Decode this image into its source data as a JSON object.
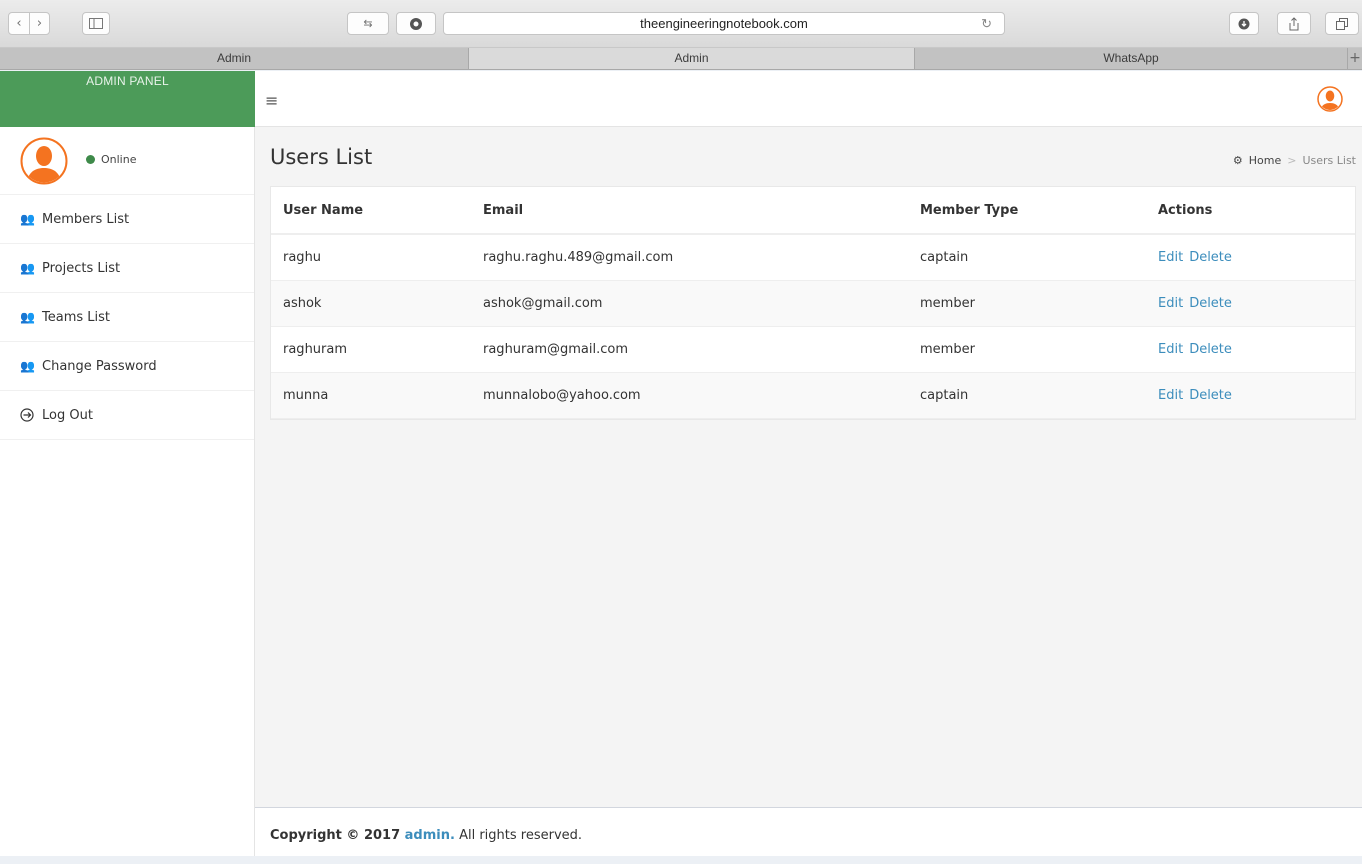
{
  "browser": {
    "url": "theengineeringnotebook.com",
    "tabs": [
      {
        "label": "Admin",
        "active": false
      },
      {
        "label": "Admin",
        "active": true
      },
      {
        "label": "WhatsApp",
        "active": false
      }
    ],
    "new_tab": "+"
  },
  "brand": {
    "label": "ADMIN PANEL",
    "color": "#4c9b59"
  },
  "user_panel": {
    "status": "Online"
  },
  "sidebar": {
    "items": [
      {
        "label": "Members List",
        "icon": "users-icon"
      },
      {
        "label": "Projects List",
        "icon": "users-icon"
      },
      {
        "label": "Teams List",
        "icon": "users-icon"
      },
      {
        "label": "Change Password",
        "icon": "users-icon"
      },
      {
        "label": "Log Out",
        "icon": "logout-icon"
      }
    ]
  },
  "header": {
    "menu_icon": "hamburger-icon",
    "avatar_icon": "user-avatar-icon",
    "accent": "#f47320"
  },
  "page": {
    "title": "Users List",
    "breadcrumb": {
      "home": "Home",
      "separator": ">",
      "current": "Users List"
    }
  },
  "table": {
    "columns": [
      "User Name",
      "Email",
      "Member Type",
      "Actions"
    ],
    "rows": [
      {
        "username": "raghu",
        "email": "raghu.raghu.489@gmail.com",
        "type": "captain",
        "edit": "Edit",
        "delete": "Delete"
      },
      {
        "username": "ashok",
        "email": "ashok@gmail.com",
        "type": "member",
        "edit": "Edit",
        "delete": "Delete"
      },
      {
        "username": "raghuram",
        "email": "raghuram@gmail.com",
        "type": "member",
        "edit": "Edit",
        "delete": "Delete"
      },
      {
        "username": "munna",
        "email": "munnalobo@yahoo.com",
        "type": "captain",
        "edit": "Edit",
        "delete": "Delete"
      }
    ]
  },
  "footer": {
    "prefix": "Copyright © 2017 ",
    "link": "admin.",
    "suffix": " All rights reserved."
  },
  "colors": {
    "link": "#3c8dbc",
    "online": "#3e8a4a"
  }
}
